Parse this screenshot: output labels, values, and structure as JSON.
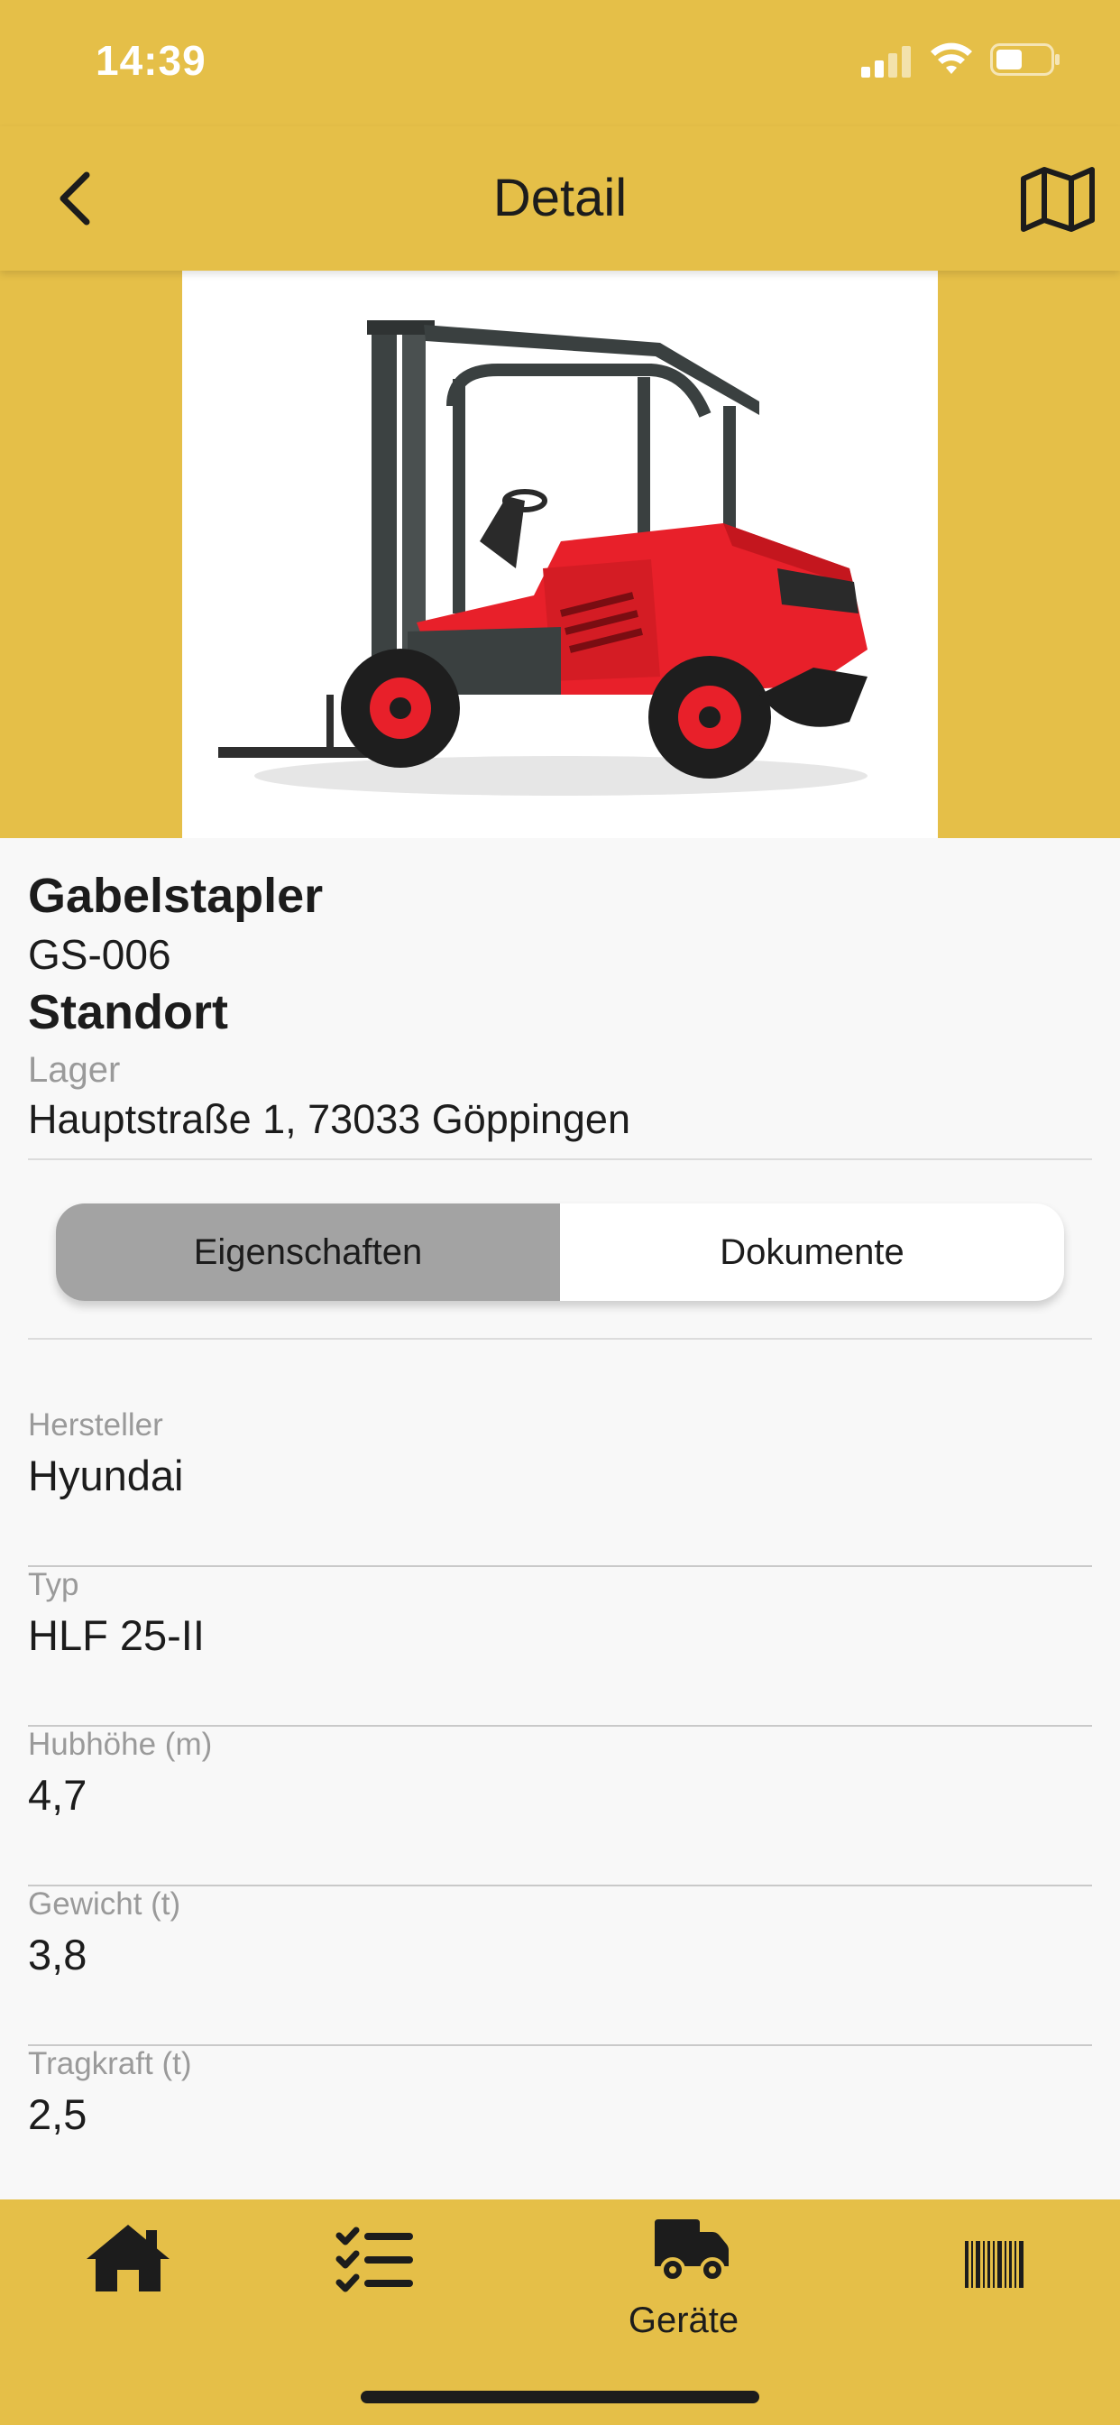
{
  "status_bar": {
    "time": "14:39",
    "signal_icon": "cellular-signal-icon",
    "wifi_icon": "wifi-icon",
    "battery_icon": "battery-icon"
  },
  "nav": {
    "title": "Detail",
    "back_icon": "chevron-left-icon",
    "map_icon": "map-icon"
  },
  "device": {
    "image": "forklift-photo",
    "type": "Gabelstapler",
    "id": "GS-006",
    "location_heading": "Standort",
    "location_name": "Lager",
    "address": "Hauptstraße 1, 73033 Göppingen"
  },
  "segments": {
    "tabs": [
      {
        "label": "Eigenschaften",
        "active": true
      },
      {
        "label": "Dokumente",
        "active": false
      }
    ]
  },
  "properties": [
    {
      "label": "Hersteller",
      "value": "Hyundai"
    },
    {
      "label": "Typ",
      "value": "HLF 25-II"
    },
    {
      "label": "Hubhöhe (m)",
      "value": "4,7"
    },
    {
      "label": "Gewicht (t)",
      "value": "3,8"
    },
    {
      "label": "Tragkraft (t)",
      "value": "2,5"
    }
  ],
  "tab_bar": {
    "items": [
      {
        "icon": "home-icon",
        "label": ""
      },
      {
        "icon": "checklist-icon",
        "label": ""
      },
      {
        "icon": "truck-icon",
        "label": "Geräte",
        "active": true
      },
      {
        "icon": "barcode-icon",
        "label": ""
      }
    ]
  },
  "colors": {
    "accent": "#e5bf48",
    "segment_active": "#a3a3a3",
    "forklift_body": "#e8202a"
  }
}
